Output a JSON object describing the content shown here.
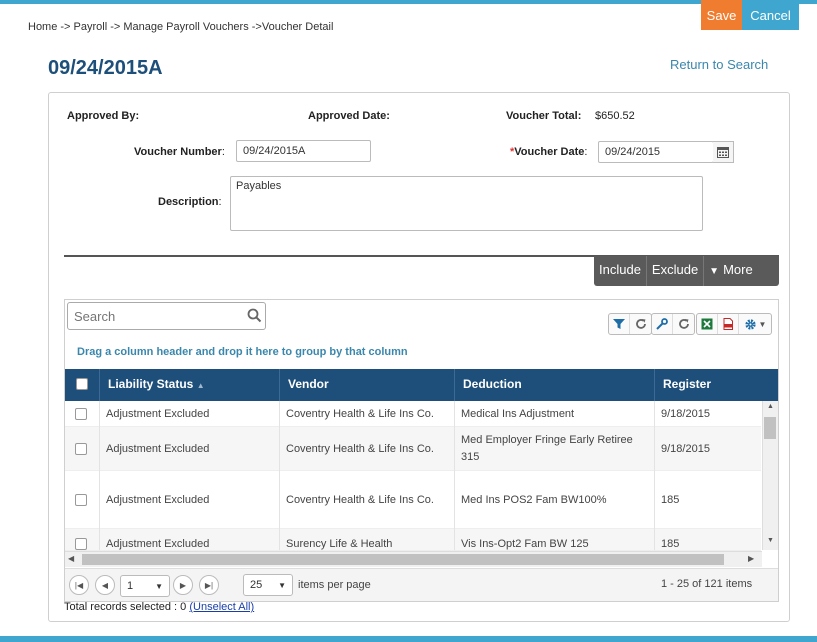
{
  "breadcrumb": "Home -> Payroll -> Manage Payroll Vouchers ->Voucher Detail",
  "actions": {
    "save": "Save",
    "cancel": "Cancel"
  },
  "title": "09/24/2015A",
  "return_link": "Return to Search",
  "form": {
    "approved_by_label": "Approved By:",
    "approved_date_label": "Approved Date:",
    "voucher_total_label": "Voucher Total:",
    "voucher_total_value": "$650.52",
    "voucher_number_label": "Voucher Number",
    "voucher_number_value": "09/24/2015A",
    "voucher_date_required": "*",
    "voucher_date_label": "Voucher Date",
    "voucher_date_value": "09/24/2015",
    "description_label": "Description",
    "description_value": "Payables",
    "colon": ":"
  },
  "action_bar": {
    "include": "Include",
    "exclude": "Exclude",
    "more": "More"
  },
  "grid": {
    "search_placeholder": "Search",
    "group_hint": "Drag a column header and drop it here to group by that column",
    "columns": [
      "Liability Status",
      "Vendor",
      "Deduction",
      "Register"
    ],
    "rows": [
      {
        "status": "Adjustment Excluded",
        "vendor": "Coventry Health & Life Ins Co.",
        "deduction": "Medical Ins Adjustment",
        "register": "9/18/2015"
      },
      {
        "status": "Adjustment Excluded",
        "vendor": "Coventry Health & Life Ins Co.",
        "deduction": "Med Employer Fringe Early Retiree 315",
        "register": "9/18/2015"
      },
      {
        "status": "Adjustment Excluded",
        "vendor": "Coventry Health & Life Ins Co.",
        "deduction": "Med Ins POS2 Fam BW100%",
        "register": "185"
      },
      {
        "status": "Adjustment Excluded",
        "vendor": "Surency Life & Health",
        "deduction": "Vis Ins-Opt2 Fam BW 125",
        "register": "185"
      }
    ]
  },
  "pager": {
    "page": "1",
    "page_size": "25",
    "items_per_page": "items per page",
    "range": "1 - 25 of 121 items"
  },
  "footer": {
    "total_selected": "Total records selected : 0",
    "unselect_all": "(Unselect All)"
  },
  "colors": {
    "accent": "#3fa7cf",
    "save": "#f07c30",
    "header": "#1d4f7a",
    "link": "#3a87ad"
  }
}
